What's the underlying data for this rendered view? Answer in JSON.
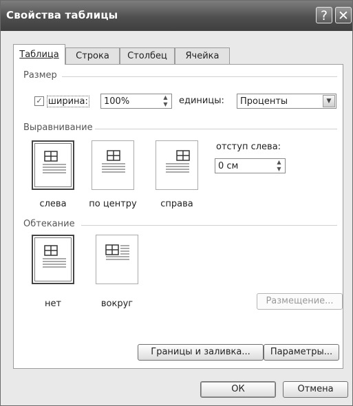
{
  "window": {
    "title": "Свойства таблицы",
    "help_glyph": "?",
    "close_glyph": "✕"
  },
  "tabs": [
    {
      "label": "Таблица",
      "mnemonic_index": 0,
      "active": true
    },
    {
      "label": "Строка",
      "mnemonic_index": 0,
      "active": false
    },
    {
      "label": "Столбец",
      "mnemonic_index": 3,
      "active": false
    },
    {
      "label": "Ячейка",
      "mnemonic_index": 0,
      "active": false
    }
  ],
  "size": {
    "section_label": "Размер",
    "width_checkbox_label": "ширина:",
    "width_checked": true,
    "width_value": "100%",
    "units_label": "единицы:",
    "units_value": "Проценты"
  },
  "alignment": {
    "section_label": "Выравнивание",
    "options": [
      {
        "label": "слева",
        "align": "left",
        "selected": true
      },
      {
        "label": "по центру",
        "align": "center",
        "selected": false
      },
      {
        "label": "справа",
        "align": "right",
        "selected": false
      }
    ],
    "indent_label": "отступ слева:",
    "indent_value": "0 см"
  },
  "wrapping": {
    "section_label": "Обтекание",
    "options": [
      {
        "label": "нет",
        "wrap": "none",
        "selected": true
      },
      {
        "label": "вокруг",
        "wrap": "around",
        "selected": false
      }
    ],
    "positioning_button": "Размещение..."
  },
  "buttons": {
    "borders_shading": "Границы и заливка...",
    "options": "Параметры...",
    "ok": "ОК",
    "cancel": "Отмена"
  },
  "icons": {
    "help": "help-icon",
    "close": "close-icon",
    "checkbox": "check-icon",
    "spinner": "spinner-arrows-icon",
    "dropdown": "chevron-down-icon"
  },
  "colors": {
    "titlebar": "#4f4f4f",
    "dialog_bg": "#e9e9e9",
    "panel_bg": "#ffffff"
  }
}
